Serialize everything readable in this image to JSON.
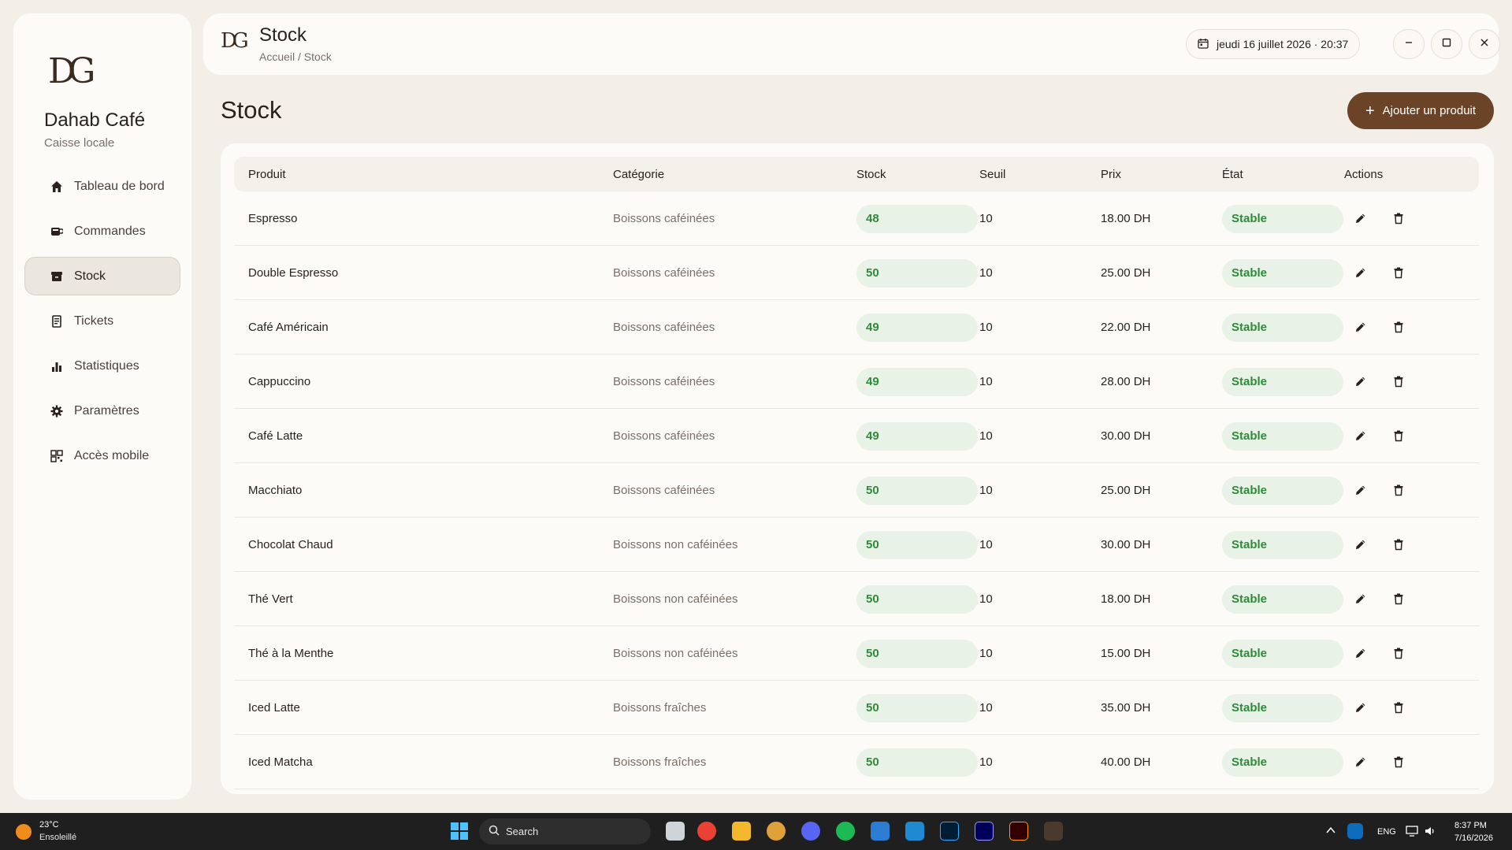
{
  "sidebar": {
    "logo_text": "DG",
    "brand_name": "Dahab Café",
    "brand_sub": "Caisse locale",
    "items": [
      {
        "label": "Tableau de bord",
        "icon": "home-icon"
      },
      {
        "label": "Commandes",
        "icon": "cup-icon"
      },
      {
        "label": "Stock",
        "icon": "box-icon",
        "active": true
      },
      {
        "label": "Tickets",
        "icon": "receipt-icon"
      },
      {
        "label": "Statistiques",
        "icon": "bar-chart-icon"
      },
      {
        "label": "Paramètres",
        "icon": "gear-icon"
      },
      {
        "label": "Accès mobile",
        "icon": "qr-code-icon"
      }
    ]
  },
  "header": {
    "logo_text": "DG",
    "title": "Stock",
    "breadcrumb": "Accueil / Stock",
    "datetime": "jeudi 16 juillet 2026 · 20:37"
  },
  "main": {
    "title": "Stock",
    "add_button": "Ajouter un produit",
    "columns": [
      "Produit",
      "Catégorie",
      "Stock",
      "Seuil",
      "Prix",
      "État",
      "Actions"
    ],
    "rows": [
      {
        "product": "Espresso",
        "category": "Boissons caféinées",
        "stock": "48",
        "threshold": "10",
        "price": "18.00 DH",
        "state": "Stable"
      },
      {
        "product": "Double Espresso",
        "category": "Boissons caféinées",
        "stock": "50",
        "threshold": "10",
        "price": "25.00 DH",
        "state": "Stable"
      },
      {
        "product": "Café Américain",
        "category": "Boissons caféinées",
        "stock": "49",
        "threshold": "10",
        "price": "22.00 DH",
        "state": "Stable"
      },
      {
        "product": "Cappuccino",
        "category": "Boissons caféinées",
        "stock": "49",
        "threshold": "10",
        "price": "28.00 DH",
        "state": "Stable"
      },
      {
        "product": "Café Latte",
        "category": "Boissons caféinées",
        "stock": "49",
        "threshold": "10",
        "price": "30.00 DH",
        "state": "Stable"
      },
      {
        "product": "Macchiato",
        "category": "Boissons caféinées",
        "stock": "50",
        "threshold": "10",
        "price": "25.00 DH",
        "state": "Stable"
      },
      {
        "product": "Chocolat Chaud",
        "category": "Boissons non caféinées",
        "stock": "50",
        "threshold": "10",
        "price": "30.00 DH",
        "state": "Stable"
      },
      {
        "product": "Thé Vert",
        "category": "Boissons non caféinées",
        "stock": "50",
        "threshold": "10",
        "price": "18.00 DH",
        "state": "Stable"
      },
      {
        "product": "Thé à la Menthe",
        "category": "Boissons non caféinées",
        "stock": "50",
        "threshold": "10",
        "price": "15.00 DH",
        "state": "Stable"
      },
      {
        "product": "Iced Latte",
        "category": "Boissons fraîches",
        "stock": "50",
        "threshold": "10",
        "price": "35.00 DH",
        "state": "Stable"
      },
      {
        "product": "Iced Matcha",
        "category": "Boissons fraîches",
        "stock": "50",
        "threshold": "10",
        "price": "40.00 DH",
        "state": "Stable"
      }
    ]
  },
  "taskbar": {
    "temperature": "23°C",
    "weather": "Ensoleillé",
    "search_placeholder": "Search",
    "language": "ENG",
    "time": "8:37 PM",
    "date": "7/16/2026"
  },
  "colors": {
    "accent": "#6b4428",
    "success": "#2f8a3a",
    "success_bg": "#e8f2e6"
  }
}
